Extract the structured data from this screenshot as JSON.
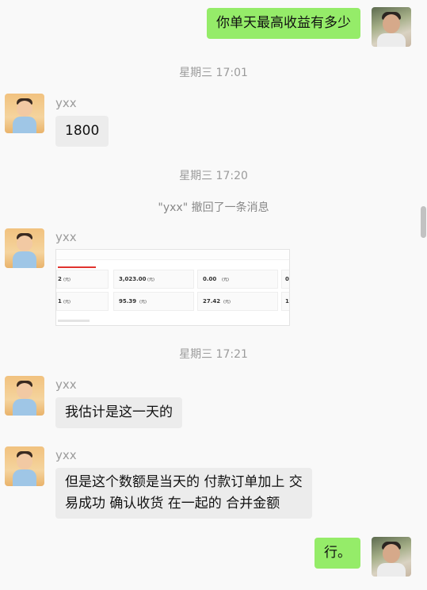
{
  "contact": {
    "nickname": "yxx"
  },
  "messages": {
    "m1": "你单天最高收益有多少",
    "m2": "1800",
    "m3": "我估计是这一天的",
    "m4_line1": "但是这个数额是当天的 付款订单加上 交",
    "m4_line2": "易成功 确认收货 在一起的 合并金额",
    "m5": "行。"
  },
  "timestamps": {
    "t1": "星期三 17:01",
    "t2": "星期三 17:20",
    "t3": "星期三 17:21"
  },
  "system": {
    "recall": "\"yxx\" 撤回了一条消息"
  },
  "screenshot_message": {
    "cells": [
      {
        "value": "2",
        "unit": "(元)"
      },
      {
        "value": "3,023.00",
        "unit": "(元)"
      },
      {
        "value": "0.00",
        "unit": "(元)"
      },
      {
        "value": "0",
        "unit": ""
      },
      {
        "value": "1",
        "unit": "(元)"
      },
      {
        "value": "95.39",
        "unit": "(元)"
      },
      {
        "value": "27.42",
        "unit": "(元)"
      },
      {
        "value": "1",
        "unit": ""
      }
    ]
  },
  "icons": {
    "self_avatar": "self-avatar-photo",
    "contact_avatar": "contact-avatar-photo"
  },
  "colors": {
    "outgoing_bubble": "#95ec69",
    "incoming_bubble": "#ececec",
    "background": "#f9f9f9",
    "meta_text": "#9b9b9b"
  }
}
